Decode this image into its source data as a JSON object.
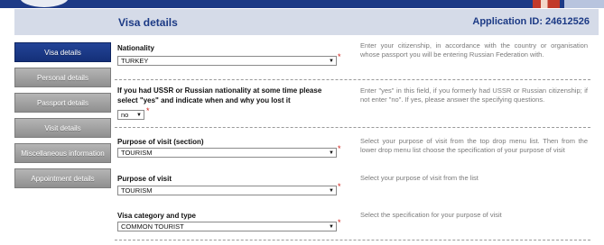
{
  "header": {
    "title": "Visa details",
    "application_id": "Application ID: 24612526"
  },
  "sidebar": {
    "items": [
      {
        "label": "Visa details",
        "active": true
      },
      {
        "label": "Personal details"
      },
      {
        "label": "Passport details"
      },
      {
        "label": "Visit details"
      },
      {
        "label": "Miscellaneous information"
      },
      {
        "label": "Appointment details"
      }
    ]
  },
  "form": {
    "nationality": {
      "label": "Nationality",
      "value": "TURKEY",
      "help": "Enter your citizenship, in accordance with the country or organisation whose passport you will be entering Russian Federation with."
    },
    "ussr": {
      "label": "If you had USSR or Russian nationality at some time please select \"yes\" and indicate when and why you lost it",
      "value": "no",
      "help": "Enter \"yes\" in this field, if you formerly had USSR or Russian citizenship; if not enter \"no\". If yes, please answer the specifying questions."
    },
    "purpose_section": {
      "label": "Purpose of visit (section)",
      "value": "TOURISM",
      "help": "Select your purpose of visit from the top drop menu list. Then from the lower drop menu list choose the specification of your purpose of visit"
    },
    "purpose": {
      "label": "Purpose of visit",
      "value": "TOURISM",
      "help": "Select your purpose of visit from the list"
    },
    "category": {
      "label": "Visa category and type",
      "value": "COMMON TOURIST",
      "help": "Select the specification for your purpose of visit"
    },
    "required_mark": "*",
    "arrow_glyph": "▼"
  },
  "colors": {
    "brand": "#1c3a85",
    "sidebar_active": "#1b3a8b",
    "sidebar_item": "#9e9e9e",
    "required": "#d0201a"
  }
}
